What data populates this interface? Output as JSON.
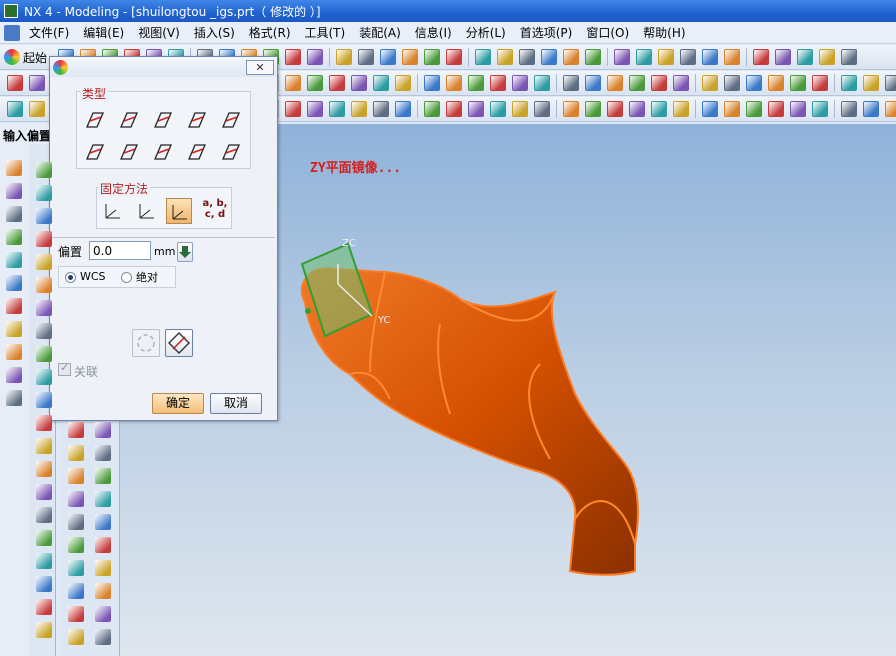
{
  "window": {
    "title": "NX 4 - Modeling - [shuilongtou _igs.prt（ 修改的 ）]"
  },
  "menu": [
    "文件(F)",
    "编辑(E)",
    "视图(V)",
    "插入(S)",
    "格式(R)",
    "工具(T)",
    "装配(A)",
    "信息(I)",
    "分析(L)",
    "首选项(P)",
    "窗口(O)",
    "帮助(H)"
  ],
  "toolbar": {
    "start_label": "起始"
  },
  "left_panel": {
    "label": "输入偏置"
  },
  "viewport": {
    "annotation": "ZY平面镜像...",
    "axis_zc": "ZC",
    "axis_yc": "YC",
    "model_color": "#d45000",
    "plane_color": "#2fa02f"
  },
  "dialog": {
    "type_group_label": "类型",
    "fixed_method_label": "固定方法",
    "coef_label": "a, b,\nc, d",
    "offset_label": "偏置",
    "offset_value": "0.0",
    "offset_unit": "mm",
    "radio_wcs": "WCS",
    "radio_absolute": "绝对",
    "associate_label": "关联",
    "ok_label": "确定",
    "cancel_label": "取消"
  }
}
